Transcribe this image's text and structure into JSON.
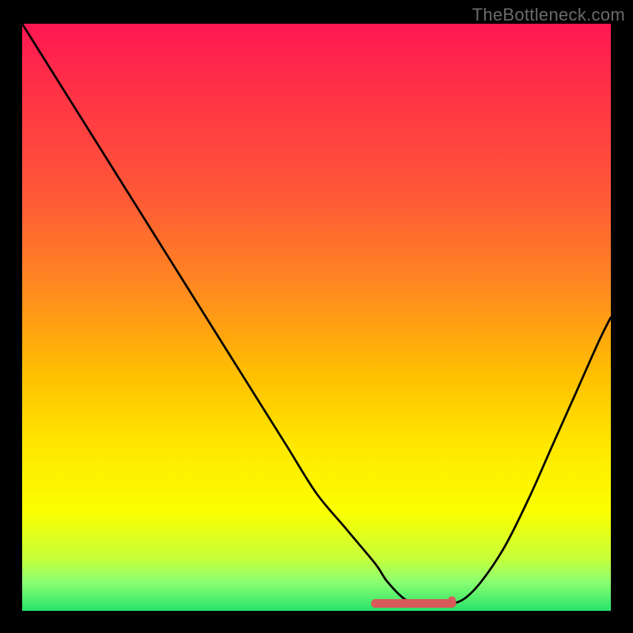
{
  "watermark": "TheBottleneck.com",
  "colors": {
    "curve": "#000000",
    "optimal_marker": "#d85a5a",
    "background_border": "#000000"
  },
  "chart_data": {
    "type": "line",
    "title": "",
    "xlabel": "",
    "ylabel": "",
    "xlim": [
      0,
      100
    ],
    "ylim": [
      0,
      100
    ],
    "grid": false,
    "legend": false,
    "series": [
      {
        "name": "bottleneck-curve",
        "x": [
          0,
          5,
          10,
          15,
          20,
          25,
          30,
          35,
          40,
          45,
          50,
          55,
          60,
          62,
          65,
          68,
          70,
          72,
          75,
          78,
          82,
          86,
          90,
          94,
          98,
          100
        ],
        "y": [
          100,
          92,
          84,
          76,
          68,
          60,
          52,
          44,
          36,
          28,
          20,
          14,
          8,
          5,
          2,
          1,
          1,
          1,
          2,
          5,
          11,
          19,
          28,
          37,
          46,
          50
        ],
        "note": "y is bottleneck percentage (0 = ideal, 100 = worst). The curve descends from top-left to a flat minimum around x≈65–72, then rises toward the right."
      }
    ],
    "optimal_range": {
      "x_start": 60,
      "x_end": 73,
      "y": 1,
      "marker": "thick red segment with endpoint dot — region of lowest bottleneck"
    },
    "background_gradient": {
      "orientation": "vertical",
      "stops": [
        {
          "pos": 0.0,
          "color": "#ff1752"
        },
        {
          "pos": 0.45,
          "color": "#ff8a20"
        },
        {
          "pos": 0.72,
          "color": "#ffe800"
        },
        {
          "pos": 0.91,
          "color": "#c8ff3a"
        },
        {
          "pos": 1.0,
          "color": "#27e36b"
        }
      ],
      "meaning": "red = high bottleneck, green = low bottleneck"
    }
  }
}
